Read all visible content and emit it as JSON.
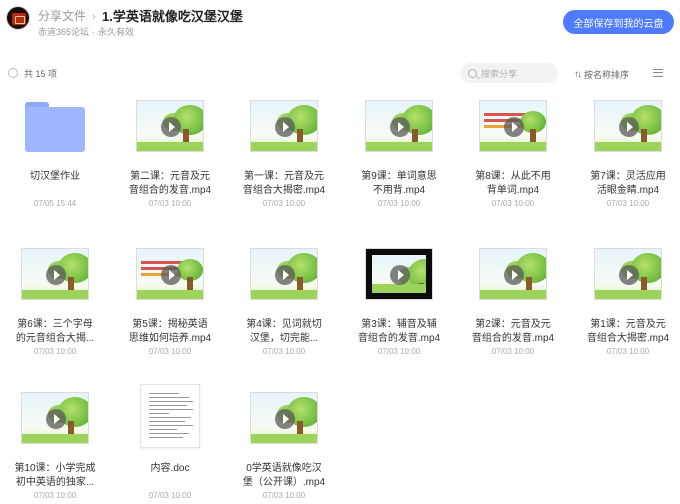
{
  "header": {
    "breadcrumb_root": "分享文件",
    "breadcrumb_sep": "›",
    "title": "1.学英语就像吃汉堡汉堡",
    "source": "赤道365论坛",
    "source_sep": "·",
    "validity": "永久有效",
    "save_all_label": "全部保存到我的云盘"
  },
  "toolbar": {
    "count_label": "共 15 项",
    "search_placeholder": "搜索分享",
    "sort_label": "按名称排序",
    "sort_icon": "sort-arrows-icon",
    "view_icon": "list-menu-icon"
  },
  "files": [
    {
      "name": "切汉堡作业",
      "date": "07/05 15:44",
      "type": "folder"
    },
    {
      "name": "第二课：元音及元音组合的发音.mp4",
      "date": "07/03 10:00",
      "type": "video"
    },
    {
      "name": "第一课：元音及元音组合大揭密.mp4",
      "date": "07/03 10:00",
      "type": "video"
    },
    {
      "name": "第9课：单词意思不用背.mp4",
      "date": "07/03 10:00",
      "type": "video"
    },
    {
      "name": "第8课：从此不用背单词.mp4",
      "date": "07/03 10:00",
      "type": "video-red"
    },
    {
      "name": "第7课：灵活应用活眼金睛.mp4",
      "date": "07/03 10:00",
      "type": "video"
    },
    {
      "name": "第6课：三个字母的元音组合大揭...",
      "date": "07/03 10:00",
      "type": "video"
    },
    {
      "name": "第5课：揭秘英语思维如何培养.mp4",
      "date": "07/03 10:00",
      "type": "video-red"
    },
    {
      "name": "第4课：见词就切汉堡，切完能...",
      "date": "07/03 10:00",
      "type": "video"
    },
    {
      "name": "第3课：辅音及辅音组合的发音.mp4",
      "date": "07/03 10:00",
      "type": "video-dark"
    },
    {
      "name": "第2课：元音及元音组合的发音.mp4",
      "date": "07/03 10:00",
      "type": "video"
    },
    {
      "name": "第1课：元音及元音组合大揭密.mp4",
      "date": "07/03 10:00",
      "type": "video"
    },
    {
      "name": "第10课：小学完成初中英语的独家...",
      "date": "07/03 10:00",
      "type": "video"
    },
    {
      "name": "内容.doc",
      "date": "07/03 10:00",
      "type": "doc"
    },
    {
      "name": "0学英语就像吃汉堡（公开课）.mp4",
      "date": "07/03 10:00",
      "type": "video"
    }
  ],
  "colors": {
    "accent": "#4e7bff",
    "folder": "#9fb7ff"
  }
}
